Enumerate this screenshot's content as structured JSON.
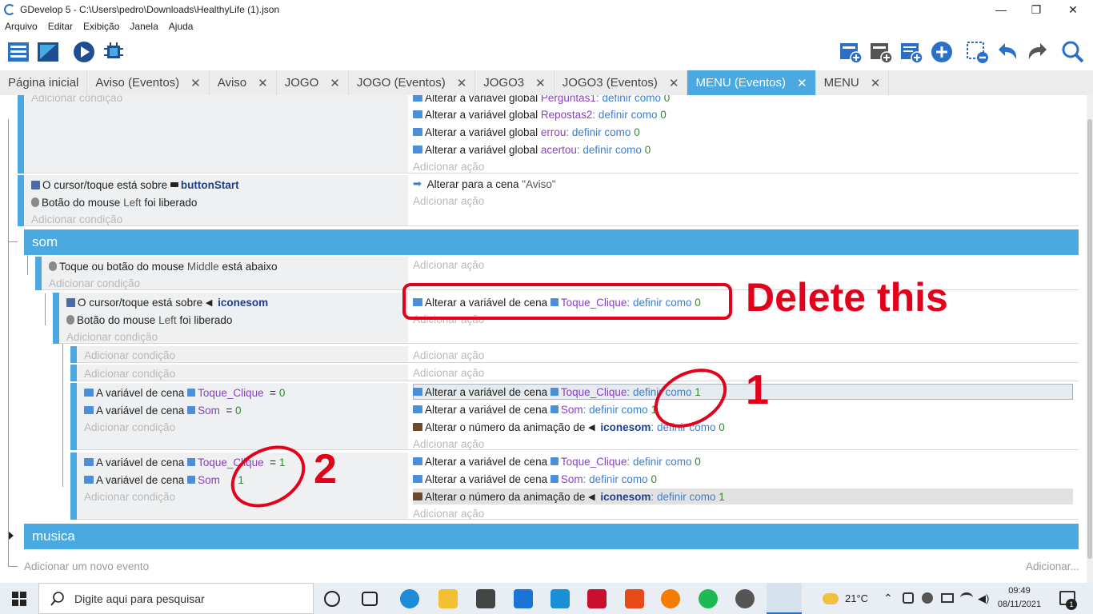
{
  "window": {
    "title": "GDevelop 5 - C:\\Users\\pedro\\Downloads\\HealthyLife (1).json",
    "minimize": "—",
    "restore": "❐",
    "close": "✕"
  },
  "menu": [
    "Arquivo",
    "Editar",
    "Exibição",
    "Janela",
    "Ajuda"
  ],
  "tabs": [
    {
      "label": "Página inicial",
      "closable": false
    },
    {
      "label": "Aviso (Eventos)",
      "closable": true
    },
    {
      "label": "Aviso",
      "closable": true
    },
    {
      "label": "JOGO",
      "closable": true
    },
    {
      "label": "JOGO (Eventos)",
      "closable": true
    },
    {
      "label": "JOGO3",
      "closable": true
    },
    {
      "label": "JOGO3 (Eventos)",
      "closable": true
    },
    {
      "label": "MENU (Eventos)",
      "closable": true,
      "active": true
    },
    {
      "label": "MENU",
      "closable": true
    }
  ],
  "tab_close": "✕",
  "text": {
    "add_condition": "Adicionar condição",
    "add_action": "Adicionar ação",
    "alter_global": "Alterar a variável global",
    "alter_scene_var": "Alterar a variável de cena",
    "scene_var": "A variável de cena",
    "set_as": "definir como",
    "cursor_over": "O cursor/toque está sobre",
    "mouse_released_pre": "Botão do mouse",
    "mouse_released_btn": "Left",
    "mouse_released_post": "foi liberado",
    "touch_down_pre": "Toque ou botão do mouse",
    "touch_down_btn": "Middle",
    "touch_down_post": "está abaixo",
    "change_scene": "Alterar para a cena",
    "change_scene_target": "\"Aviso\"",
    "anim_number": "Alterar o número da animação de",
    "eq": "=",
    "colon": ":",
    "add_new_event": "Adicionar um novo evento",
    "add_more": "Adicionar..."
  },
  "vars": {
    "perguntas1": "Perguntas1",
    "repostas2": "Repostas2",
    "errou": "errou",
    "acertou": "acertou",
    "toque_clique": "Toque_Clique",
    "som": "Som"
  },
  "objects": {
    "button_start": "buttonStart",
    "iconesom": "iconesom"
  },
  "values": {
    "zero": "0",
    "one": "1"
  },
  "groups": {
    "som": "som",
    "musica": "musica"
  },
  "annotations": {
    "delete": "Delete this",
    "one": "1",
    "two": "2"
  },
  "taskbar": {
    "search_placeholder": "Digite aqui para pesquisar",
    "weather": "21°C",
    "time": "09:49",
    "date": "08/11/2021",
    "notifications": "1"
  },
  "colors": {
    "accent": "#4aa9e0",
    "annotation": "#e3001b"
  }
}
